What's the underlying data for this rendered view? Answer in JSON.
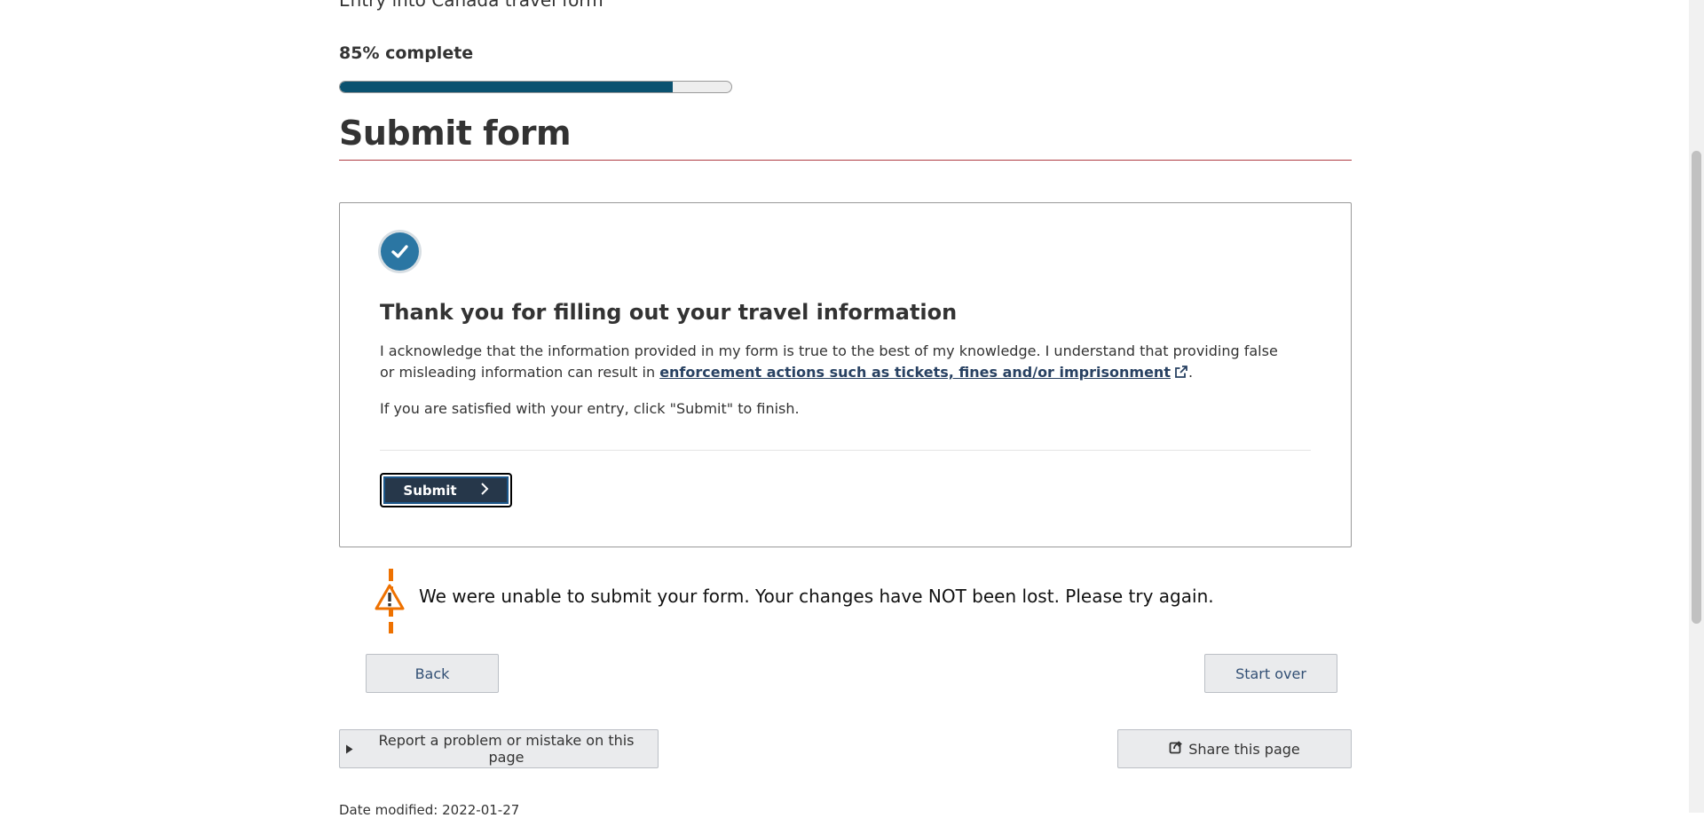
{
  "form": {
    "name": "Entry into Canada travel form",
    "progress_label": "85% complete",
    "progress_fraction": 0.85
  },
  "page": {
    "title": "Submit form"
  },
  "confirmation": {
    "heading": "Thank you for filling out your travel information",
    "ack_text": "I acknowledge that the information provided in my form is true to the best of my knowledge. I understand that providing false or misleading information can result in ",
    "ack_link": "enforcement actions such as tickets, fines and/or imprisonment",
    "ack_end": ".",
    "satisfied_text": "If you are satisfied with your entry, click \"Submit\" to finish.",
    "submit_label": "Submit"
  },
  "alert": {
    "message": "We were unable to submit your form. Your changes have NOT been lost. Please try again."
  },
  "nav": {
    "back_label": "Back",
    "start_over_label": "Start over"
  },
  "footer": {
    "report_label": "Report a problem or mistake on this page",
    "share_label": "Share this page",
    "date_modified": "Date modified: 2022-01-27"
  },
  "colors": {
    "progress_fill": "#0b5270",
    "title_rule": "#af3c43",
    "check_circle": "#2b76a3",
    "submit_bg": "#26374a",
    "link": "#284162",
    "warning": "#ee7100"
  },
  "icons": {
    "check": "check-circle-icon",
    "external": "external-link-icon",
    "chevron": "chevron-right-icon",
    "warning": "warning-icon",
    "caret": "caret-right-icon",
    "share": "share-icon"
  }
}
